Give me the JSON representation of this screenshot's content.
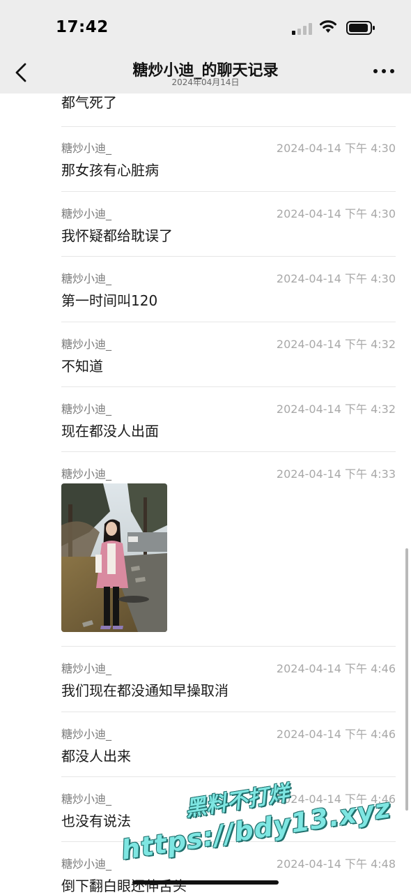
{
  "status_bar": {
    "time": "17:42"
  },
  "header": {
    "title": "糖炒小迪_的聊天记录",
    "subtitle": "2024年04月14日",
    "back_icon": "chevron-left-icon",
    "more_icon": "more-dots-icon"
  },
  "top_message": {
    "text": "都气死了"
  },
  "messages": [
    {
      "sender": "糖炒小迪_",
      "time": "2024-04-14 下午 4:30",
      "text": "那女孩有心脏病"
    },
    {
      "sender": "糖炒小迪_",
      "time": "2024-04-14 下午 4:30",
      "text": "我怀疑都给耽误了"
    },
    {
      "sender": "糖炒小迪_",
      "time": "2024-04-14 下午 4:30",
      "text": "第一时间叫120"
    },
    {
      "sender": "糖炒小迪_",
      "time": "2024-04-14 下午 4:32",
      "text": "不知道"
    },
    {
      "sender": "糖炒小迪_",
      "time": "2024-04-14 下午 4:32",
      "text": "现在都没人出面"
    },
    {
      "sender": "糖炒小迪_",
      "time": "2024-04-14 下午 4:33",
      "type": "image"
    },
    {
      "sender": "糖炒小迪_",
      "time": "2024-04-14 下午 4:46",
      "text": "我们现在都没通知早操取消"
    },
    {
      "sender": "糖炒小迪_",
      "time": "2024-04-14 下午 4:46",
      "text": "都没人出来"
    },
    {
      "sender": "糖炒小迪_",
      "time": "2024-04-14 下午 4:46",
      "text": "也没有说法"
    },
    {
      "sender": "糖炒小迪_",
      "time": "2024-04-14 下午 4:48",
      "text": "倒下翻白眼还伸舌头"
    }
  ],
  "watermark": {
    "line1": "黑料不打烊",
    "line2": "https://bdy13.xyz"
  },
  "colors": {
    "header_bg": "#ededed",
    "divider": "#e6e6e6",
    "watermark": "#7ee6e2"
  }
}
